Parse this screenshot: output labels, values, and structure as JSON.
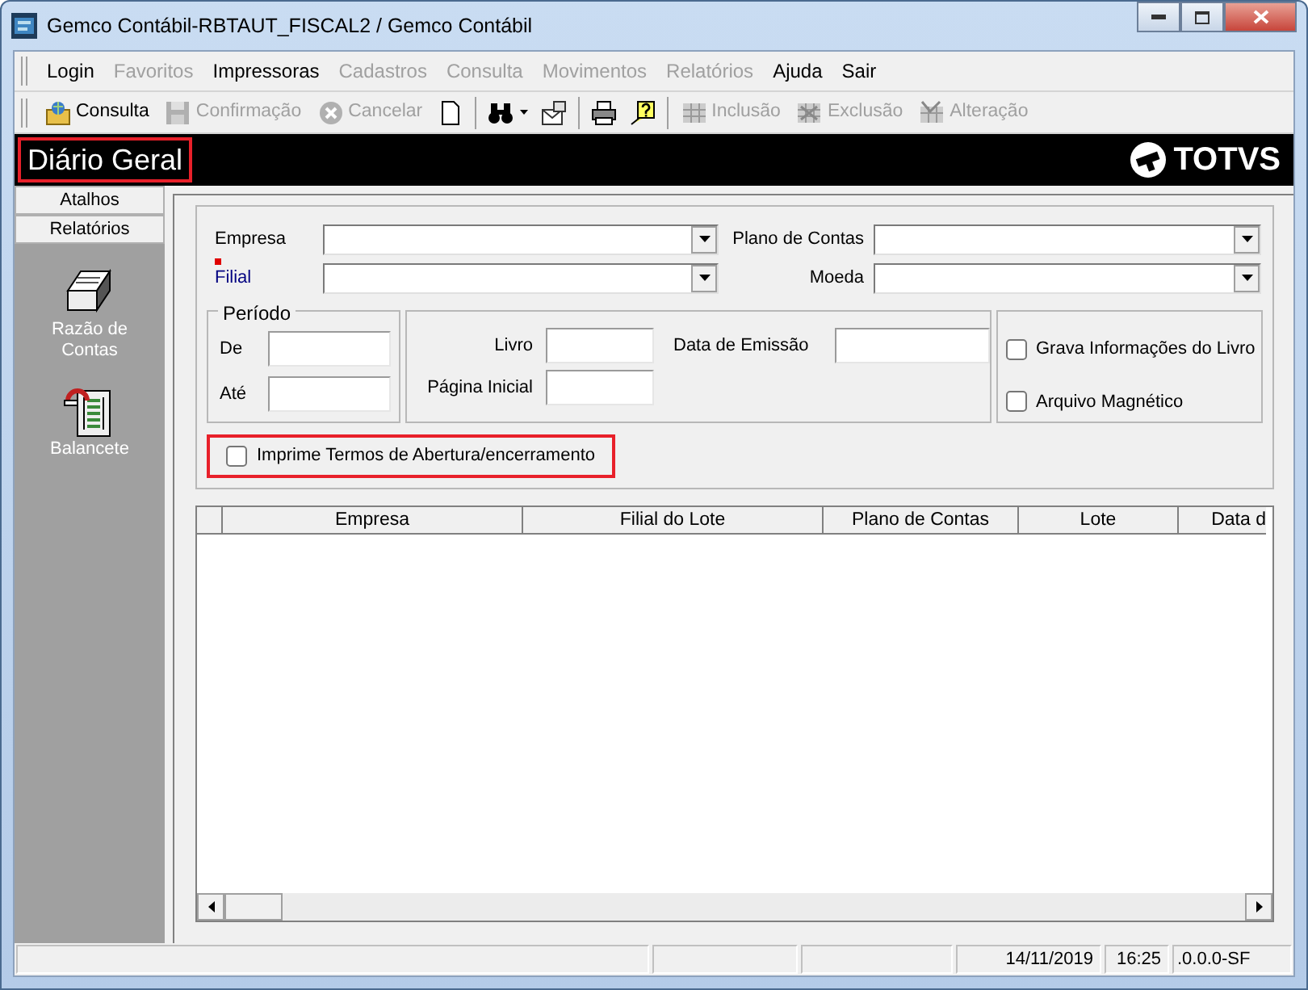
{
  "window": {
    "title": "Gemco Contábil-RBTAUT_FISCAL2 / Gemco Contábil"
  },
  "menu": [
    {
      "label": "Login",
      "disabled": false
    },
    {
      "label": "Favoritos",
      "disabled": true
    },
    {
      "label": "Impressoras",
      "disabled": false
    },
    {
      "label": "Cadastros",
      "disabled": true
    },
    {
      "label": "Consulta",
      "disabled": true
    },
    {
      "label": "Movimentos",
      "disabled": true
    },
    {
      "label": "Relatórios",
      "disabled": true
    },
    {
      "label": "Ajuda",
      "disabled": false
    },
    {
      "label": "Sair",
      "disabled": false
    }
  ],
  "toolbar": [
    {
      "kind": "button",
      "label": "Consulta",
      "disabled": false
    },
    {
      "kind": "button",
      "label": "Confirmação",
      "disabled": true
    },
    {
      "kind": "button",
      "label": "Cancelar",
      "disabled": true
    },
    {
      "kind": "icon",
      "disabled": false
    },
    {
      "kind": "separator"
    },
    {
      "kind": "icon",
      "disabled": false,
      "has_menu": true
    },
    {
      "kind": "icon",
      "disabled": false
    },
    {
      "kind": "separator"
    },
    {
      "kind": "icon",
      "disabled": false
    },
    {
      "kind": "icon",
      "disabled": false
    },
    {
      "kind": "separator"
    },
    {
      "kind": "button",
      "label": "Inclusão",
      "disabled": true
    },
    {
      "kind": "button",
      "label": "Exclusão",
      "disabled": true
    },
    {
      "kind": "button",
      "label": "Alteração",
      "disabled": true
    }
  ],
  "header": {
    "title": "Diário Geral",
    "highlighted": true,
    "logo_text": "TOTVS"
  },
  "sidebar": {
    "tabs": [
      {
        "label": "Atalhos"
      },
      {
        "label": "Relatórios"
      }
    ],
    "items": [
      {
        "label": "Razão de Contas"
      },
      {
        "label": "Balancete"
      }
    ]
  },
  "form": {
    "fields": [
      {
        "label": "Empresa",
        "required": false
      },
      {
        "label": "Plano de Contas",
        "required": false
      },
      {
        "label": "Filial",
        "required": true
      },
      {
        "label": "Moeda",
        "required": false
      }
    ],
    "period": {
      "title": "Período",
      "fields": [
        {
          "label": "De"
        },
        {
          "label": "Até"
        }
      ]
    },
    "book": {
      "fields": [
        {
          "label": "Livro"
        },
        {
          "label": "Data de Emissão"
        },
        {
          "label": "Página Inicial"
        }
      ]
    },
    "options": [
      {
        "label": "Grava Informações do Livro",
        "checked": false
      },
      {
        "label": "Arquivo Magnético",
        "checked": false
      }
    ],
    "print_terms": {
      "label": "Imprime Termos de Abertura/encerramento",
      "checked": false,
      "highlighted": true
    }
  },
  "table": {
    "columns": [
      {
        "label": "Empresa"
      },
      {
        "label": "Filial do Lote"
      },
      {
        "label": "Plano de Contas"
      },
      {
        "label": "Lote"
      },
      {
        "label": "Data d"
      }
    ]
  },
  "status_bar": [
    {
      "kind": "blank"
    },
    {
      "kind": "blank"
    },
    {
      "kind": "blank"
    },
    {
      "kind": "text",
      "text": "14/11/2019"
    },
    {
      "kind": "text",
      "text": "16:25"
    },
    {
      "kind": "text",
      "text": ".0.0.0-SF"
    }
  ]
}
